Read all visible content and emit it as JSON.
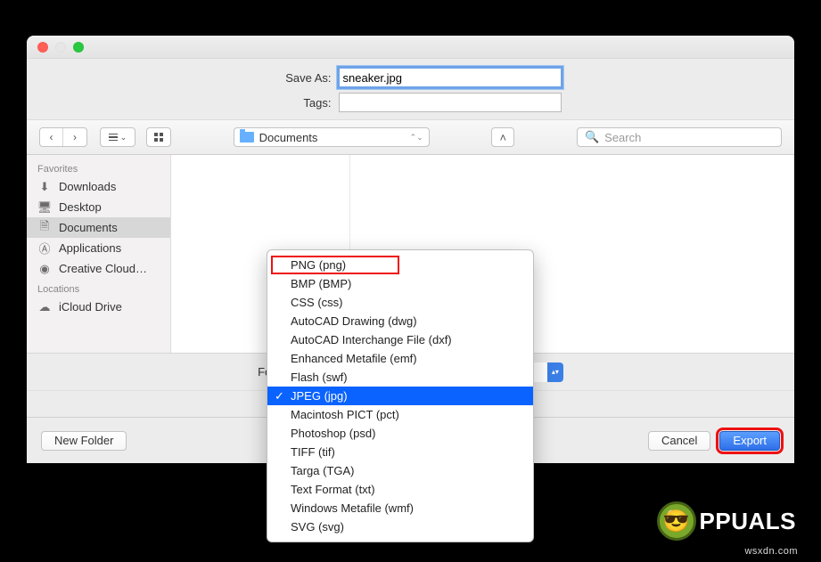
{
  "dialog": {
    "save_as_label": "Save As:",
    "save_as_value": "sneaker.jpg",
    "tags_label": "Tags:",
    "tags_value": "",
    "format_label": "Format:",
    "format_value": "JPEG (jpg)"
  },
  "toolbar": {
    "path_label": "Documents",
    "search_placeholder": "Search"
  },
  "sidebar": {
    "favorites_header": "Favorites",
    "locations_header": "Locations",
    "favorites": [
      {
        "label": "Downloads",
        "icon": "download"
      },
      {
        "label": "Desktop",
        "icon": "desktop"
      },
      {
        "label": "Documents",
        "icon": "documents",
        "selected": true
      },
      {
        "label": "Applications",
        "icon": "applications"
      },
      {
        "label": "Creative Cloud…",
        "icon": "creativecloud"
      }
    ],
    "locations": [
      {
        "label": "iCloud Drive",
        "icon": "icloud"
      }
    ]
  },
  "format_menu": [
    {
      "label": "PNG (png)",
      "highlight": true
    },
    {
      "label": "BMP (BMP)"
    },
    {
      "label": "CSS (css)"
    },
    {
      "label": "AutoCAD Drawing (dwg)"
    },
    {
      "label": "AutoCAD Interchange File (dxf)"
    },
    {
      "label": "Enhanced Metafile (emf)"
    },
    {
      "label": "Flash (swf)"
    },
    {
      "label": "JPEG (jpg)",
      "selected": true,
      "checked": true
    },
    {
      "label": "Macintosh PICT (pct)"
    },
    {
      "label": "Photoshop (psd)"
    },
    {
      "label": "TIFF (tif)"
    },
    {
      "label": "Targa (TGA)"
    },
    {
      "label": "Text Format (txt)"
    },
    {
      "label": "Windows Metafile (wmf)"
    },
    {
      "label": "SVG (svg)"
    }
  ],
  "footer": {
    "new_folder": "New Folder",
    "cancel": "Cancel",
    "export": "Export"
  },
  "branding": {
    "watermark": "wsxdn.com",
    "logo_text": "PPUALS"
  }
}
